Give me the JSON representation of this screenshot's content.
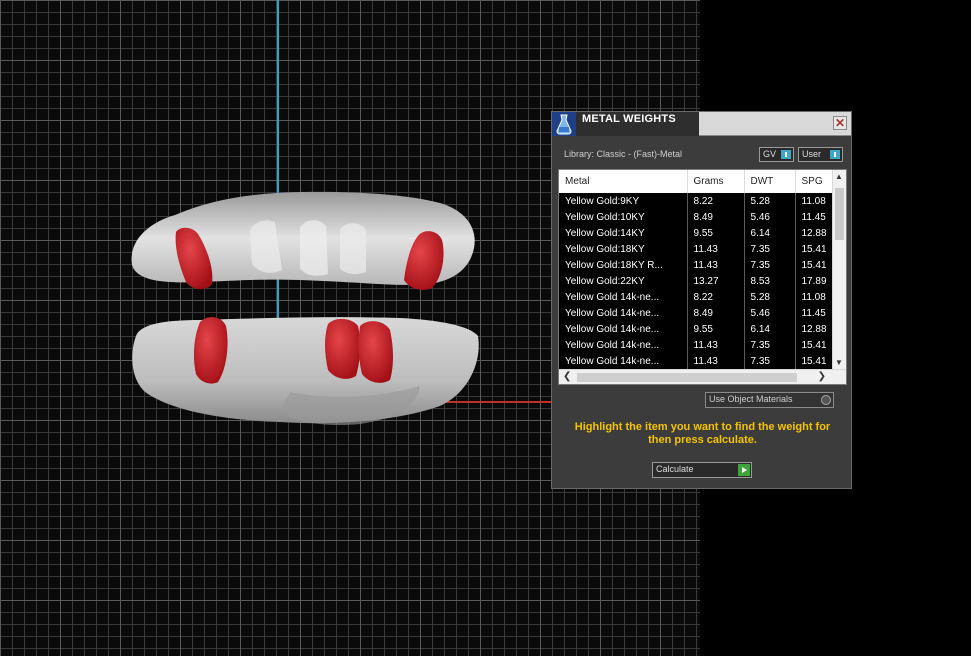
{
  "panel": {
    "title": "METAL WEIGHTS",
    "close": "✕",
    "library": "Library: Classic - (Fast)-Metal",
    "toggles": {
      "gv": "GV",
      "user": "User"
    },
    "columns": [
      "Metal",
      "Grams",
      "DWT",
      "SPG"
    ],
    "rows": [
      [
        "Yellow Gold:9KY",
        "8.22",
        "5.28",
        "11.08"
      ],
      [
        "Yellow Gold:10KY",
        "8.49",
        "5.46",
        "11.45"
      ],
      [
        "Yellow Gold:14KY",
        "9.55",
        "6.14",
        "12.88"
      ],
      [
        "Yellow Gold:18KY",
        "11.43",
        "7.35",
        "15.41"
      ],
      [
        "Yellow Gold:18KY R...",
        "11.43",
        "7.35",
        "15.41"
      ],
      [
        "Yellow Gold:22KY",
        "13.27",
        "8.53",
        "17.89"
      ],
      [
        "Yellow Gold 14k-ne...",
        "8.22",
        "5.28",
        "11.08"
      ],
      [
        "Yellow Gold 14k-ne...",
        "8.49",
        "5.46",
        "11.45"
      ],
      [
        "Yellow Gold 14k-ne...",
        "9.55",
        "6.14",
        "12.88"
      ],
      [
        "Yellow Gold 14k-ne...",
        "11.43",
        "7.35",
        "15.41"
      ],
      [
        "Yellow Gold 14k-ne...",
        "11.43",
        "7.35",
        "15.41"
      ]
    ],
    "use_object_materials": "Use Object Materials",
    "hint": "Highlight the item you want to find the weight for then press calculate.",
    "calculate": "Calculate"
  },
  "colors": {
    "accent": "#3ba8c8",
    "hint": "#f5c400",
    "model": "#c8c8c8",
    "highlight": "#c0151c"
  }
}
